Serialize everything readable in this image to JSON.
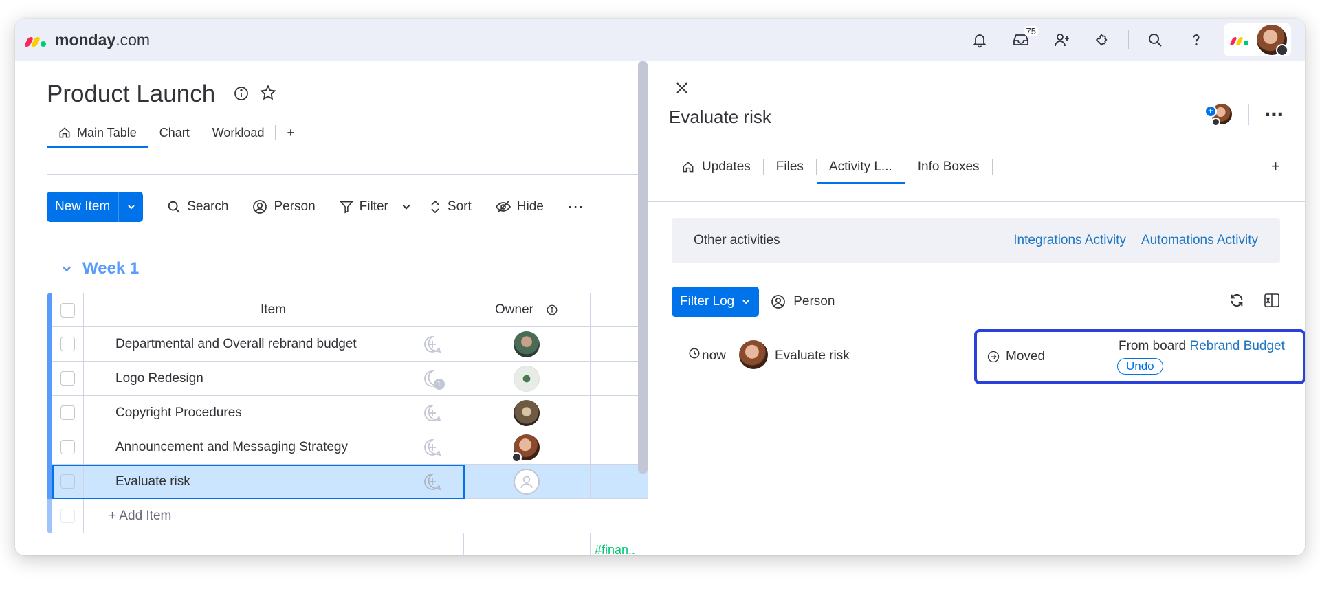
{
  "app": {
    "logo_bold": "monday",
    "logo_suffix": ".com",
    "inbox_badge": "75"
  },
  "board": {
    "title": "Product Launch",
    "tabs": [
      {
        "label": "Main Table"
      },
      {
        "label": "Chart"
      },
      {
        "label": "Workload"
      },
      {
        "label": "+"
      }
    ],
    "toolbar": {
      "new_item": "New Item",
      "search": "Search",
      "person": "Person",
      "filter": "Filter",
      "sort": "Sort",
      "hide": "Hide"
    },
    "group": {
      "title": "Week 1",
      "color": "#579bfc"
    },
    "columns": {
      "item": "Item",
      "owner": "Owner"
    },
    "rows": [
      {
        "name": "Departmental and Overall rebrand budget"
      },
      {
        "name": "Logo Redesign",
        "updates": "1"
      },
      {
        "name": "Copyright Procedures"
      },
      {
        "name": "Announcement and Messaging Strategy"
      },
      {
        "name": "Evaluate risk"
      }
    ],
    "add_item": "+ Add Item",
    "footer_tag": "#finan.."
  },
  "panel": {
    "title": "Evaluate risk",
    "tabs": [
      {
        "label": "Updates"
      },
      {
        "label": "Files"
      },
      {
        "label": "Activity L..."
      },
      {
        "label": "Info Boxes"
      }
    ],
    "tab_plus": "+",
    "other_activities": "Other activities",
    "integrations_link": "Integrations Activity",
    "automations_link": "Automations Activity",
    "filter_log": "Filter Log",
    "person": "Person",
    "log": {
      "time": "now",
      "item": "Evaluate risk",
      "action": "Moved",
      "from_prefix": "From board",
      "from_board": "Rebrand Budget",
      "undo": "Undo"
    }
  },
  "colors": {
    "primary": "#0073ea",
    "highlight_border": "#2b3fdc",
    "link": "#1f76c2",
    "selected_row": "#cce5ff"
  }
}
